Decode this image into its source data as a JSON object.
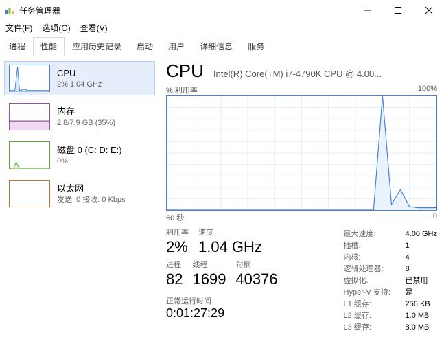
{
  "window": {
    "title": "任务管理器"
  },
  "menu": {
    "file": "文件(F)",
    "option": "选项(O)",
    "view": "查看(V)"
  },
  "tabs": {
    "processes": "进程",
    "performance": "性能",
    "apphistory": "应用历史记录",
    "startup": "启动",
    "users": "用户",
    "details": "详细信息",
    "services": "服务"
  },
  "sidebar": {
    "cpu": {
      "title": "CPU",
      "sub": "2%  1.04 GHz"
    },
    "mem": {
      "title": "内存",
      "sub": "2.8/7.9 GB (35%)"
    },
    "disk": {
      "title": "磁盘 0 (C: D: E:)",
      "sub": "0%"
    },
    "net": {
      "title": "以太网",
      "sub": "发送: 0 接收: 0 Kbps"
    }
  },
  "panel": {
    "title": "CPU",
    "model": "Intel(R) Core(TM) i7-4790K CPU @ 4.00...",
    "chart_top_left": "% 利用率",
    "chart_top_right": "100%",
    "chart_bottom_left": "60 秒",
    "chart_bottom_right": "0",
    "labels": {
      "util": "利用率",
      "speed": "速度",
      "proc": "进程",
      "thread": "线程",
      "handle": "句柄",
      "uptime": "正常运行时间"
    },
    "vals": {
      "util": "2%",
      "speed": "1.04 GHz",
      "proc": "82",
      "thread": "1699",
      "handle": "40376",
      "uptime": "0:01:27:29"
    },
    "meta": {
      "maxspeed_k": "最大速度:",
      "maxspeed_v": "4.00 GHz",
      "sockets_k": "插槽:",
      "sockets_v": "1",
      "cores_k": "内核:",
      "cores_v": "4",
      "lprocs_k": "逻辑处理器:",
      "lprocs_v": "8",
      "virt_k": "虚拟化:",
      "virt_v": "已禁用",
      "hyperv_k": "Hyper-V 支持:",
      "hyperv_v": "是",
      "l1_k": "L1 缓存:",
      "l1_v": "256 KB",
      "l2_k": "L2 缓存:",
      "l2_v": "1.0 MB",
      "l3_k": "L3 缓存:",
      "l3_v": "8.0 MB"
    }
  },
  "chart_data": {
    "type": "line",
    "title": "% 利用率",
    "xlabel": "60 秒",
    "ylabel": "",
    "ylim": [
      0,
      100
    ],
    "x_seconds_ago": [
      60,
      58,
      56,
      54,
      52,
      50,
      48,
      46,
      44,
      42,
      40,
      38,
      36,
      34,
      32,
      30,
      28,
      26,
      24,
      22,
      20,
      18,
      16,
      14,
      12,
      10,
      8,
      6,
      4,
      2,
      0
    ],
    "values": [
      0,
      0,
      0,
      0,
      0,
      0,
      0,
      0,
      0,
      0,
      0,
      0,
      0,
      0,
      0,
      0,
      0,
      0,
      0,
      0,
      0,
      0,
      0,
      0,
      100,
      5,
      18,
      3,
      2,
      2,
      2
    ]
  }
}
